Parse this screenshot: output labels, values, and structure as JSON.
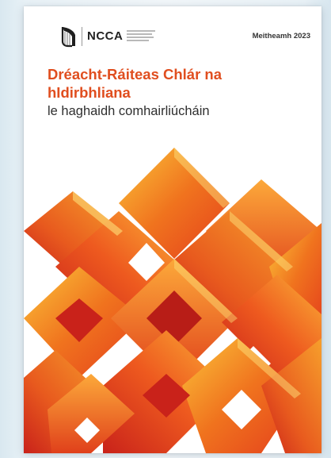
{
  "document": {
    "organization": "NCCA",
    "date": "Meitheamh 2023",
    "title": "Dréacht-Ráiteas Chlár na\nhIdirbhliana",
    "subtitle": "le haghaidh comhairliúcháin"
  },
  "colors": {
    "title_orange": "#e04e1f",
    "art_dark_red": "#c9221a",
    "art_red": "#e43f1c",
    "art_orange": "#f0731e",
    "art_light_orange": "#f7a02c",
    "art_yellow": "#fbc43a"
  },
  "icons": {
    "logo": "irish-harp-icon"
  }
}
